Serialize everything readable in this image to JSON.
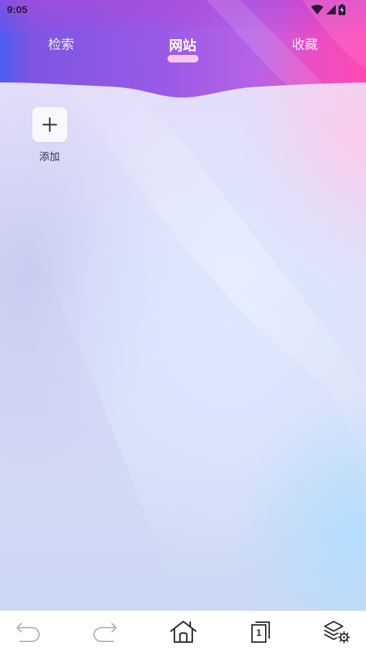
{
  "status_bar": {
    "time": "9:05",
    "icons": [
      "wifi-icon",
      "signal-icon",
      "battery-charging-icon"
    ]
  },
  "tabs": [
    {
      "label": "检索",
      "active": false
    },
    {
      "label": "网站",
      "active": true
    },
    {
      "label": "收藏",
      "active": false
    }
  ],
  "sites": {
    "add_label": "添加",
    "add_icon": "plus-icon"
  },
  "bottom_nav": {
    "items": [
      "back-arrow-icon",
      "forward-arrow-icon",
      "home-icon",
      "tabs-icon",
      "layers-settings-icon"
    ],
    "tab_count": "1"
  },
  "colors": {
    "header_left": "#4a5cf0",
    "header_mid": "#9a5ae6",
    "header_right": "#ff48b4",
    "tab_indicator": "#f6c8ee"
  }
}
